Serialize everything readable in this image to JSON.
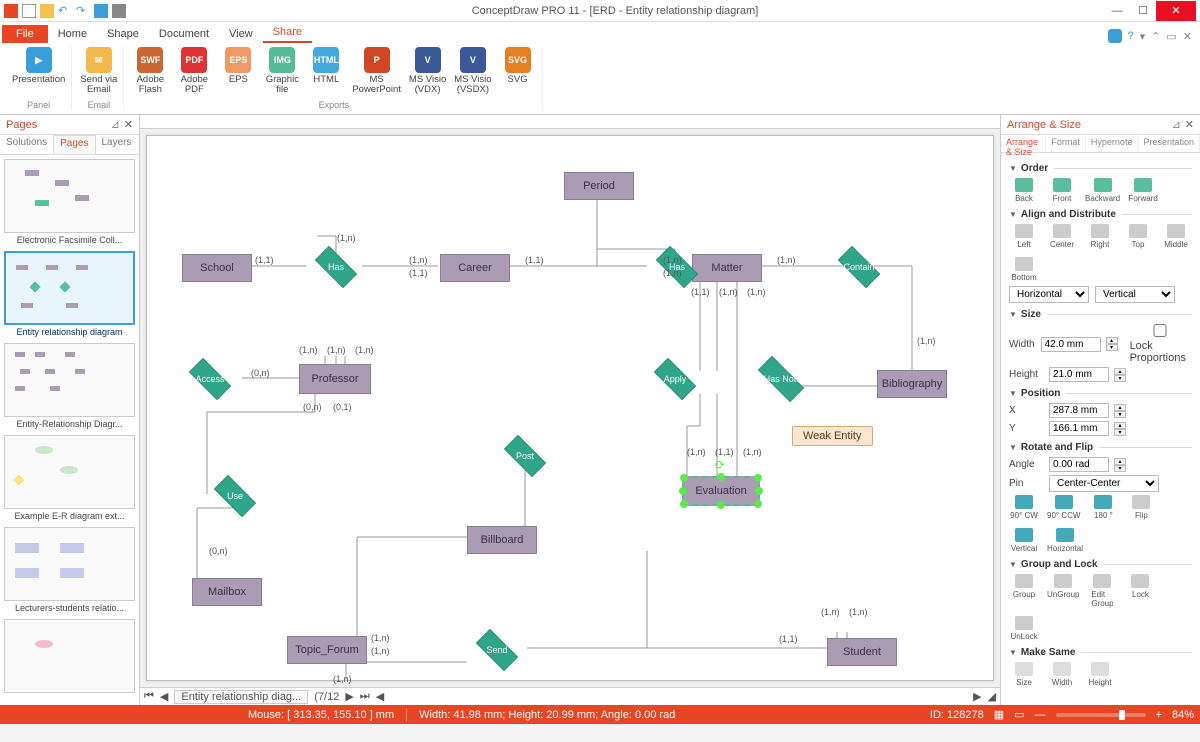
{
  "title": "ConceptDraw PRO 11 - [ERD - Entity relationship diagram]",
  "ribbonTabs": {
    "file": "File",
    "home": "Home",
    "shape": "Shape",
    "document": "Document",
    "view": "View",
    "share": "Share"
  },
  "ribbonGroups": {
    "panel": {
      "presentation": "Presentation",
      "label": "Panel"
    },
    "email": {
      "send": "Send via\nEmail",
      "label": "Email"
    },
    "exports": {
      "flash": "Adobe\nFlash",
      "pdf": "Adobe\nPDF",
      "eps": "EPS",
      "graphic": "Graphic\nfile",
      "html": "HTML",
      "ppt": "MS\nPowerPoint",
      "vdx": "MS Visio\n(VDX)",
      "vsdx": "MS Visio\n(VSDX)",
      "svg": "SVG",
      "label": "Exports"
    }
  },
  "leftPanel": {
    "title": "Pages",
    "tabs": {
      "solutions": "Solutions",
      "pages": "Pages",
      "layers": "Layers"
    },
    "thumbs": [
      {
        "label": "Electronic Facsimile Coll..."
      },
      {
        "label": "Entity relationship diagram",
        "active": true
      },
      {
        "label": "Entity-Relationship Diagr..."
      },
      {
        "label": "Example E-R diagram ext..."
      },
      {
        "label": "Lecturers-students relatio..."
      }
    ]
  },
  "diagram": {
    "entities": {
      "period": "Period",
      "school": "School",
      "career": "Career",
      "matter": "Matter",
      "professor": "Professor",
      "bibliography": "Bibliography",
      "billboard": "Billboard",
      "mailbox": "Mailbox",
      "topic": "Topic_Forum",
      "student": "Student",
      "evaluation": "Evaluation"
    },
    "relationships": {
      "has1": "Has",
      "has2": "Has",
      "contain": "Contain",
      "access": "Access",
      "apply": "Apply",
      "ithasnotes": "It Has Notes",
      "use": "Use",
      "post": "Post",
      "send": "Send"
    },
    "tooltip": "Weak Entity",
    "cards": {
      "c11": "(1,1)",
      "c1n": "(1,n)",
      "c0n": "(0,n)",
      "c01": "(0,1)"
    }
  },
  "bottomTabs": {
    "doc": "Entity relationship diag...",
    "pages": "(7/12"
  },
  "rightPanel": {
    "title": "Arrange & Size",
    "tabs": {
      "arrange": "Arrange & Size",
      "format": "Format",
      "hypernote": "Hypernote",
      "presentation": "Presentation"
    },
    "order": {
      "title": "Order",
      "back": "Back",
      "front": "Front",
      "backward": "Backward",
      "forward": "Forward"
    },
    "align": {
      "title": "Align and Distribute",
      "left": "Left",
      "center": "Center",
      "right": "Right",
      "top": "Top",
      "middle": "Middle",
      "bottom": "Bottom",
      "horizontal": "Horizontal",
      "vertical": "Vertical"
    },
    "size": {
      "title": "Size",
      "widthLbl": "Width",
      "width": "42.0 mm",
      "heightLbl": "Height",
      "height": "21.0 mm",
      "lock": "Lock Proportions"
    },
    "position": {
      "title": "Position",
      "xLbl": "X",
      "x": "287.8 mm",
      "yLbl": "Y",
      "y": "166.1 mm"
    },
    "rotate": {
      "title": "Rotate and Flip",
      "angleLbl": "Angle",
      "angle": "0.00 rad",
      "pinLbl": "Pin",
      "pin": "Center-Center",
      "cw": "90° CW",
      "ccw": "90° CCW",
      "r180": "180 °",
      "flip": "Flip",
      "v": "Vertical",
      "h": "Horizontal"
    },
    "group": {
      "title": "Group and Lock",
      "group": "Group",
      "ungroup": "UnGroup",
      "edit": "Edit\nGroup",
      "lock": "Lock",
      "unlock": "UnLock"
    },
    "same": {
      "title": "Make Same",
      "size": "Size",
      "width": "Width",
      "height": "Height"
    }
  },
  "statusBar": {
    "mouse": "Mouse: [ 313.35, 155.10 ] mm",
    "dims": "Width: 41.98 mm;  Height: 20.99 mm;  Angle: 0.00 rad",
    "id": "ID: 128278",
    "zoom": "84%"
  }
}
